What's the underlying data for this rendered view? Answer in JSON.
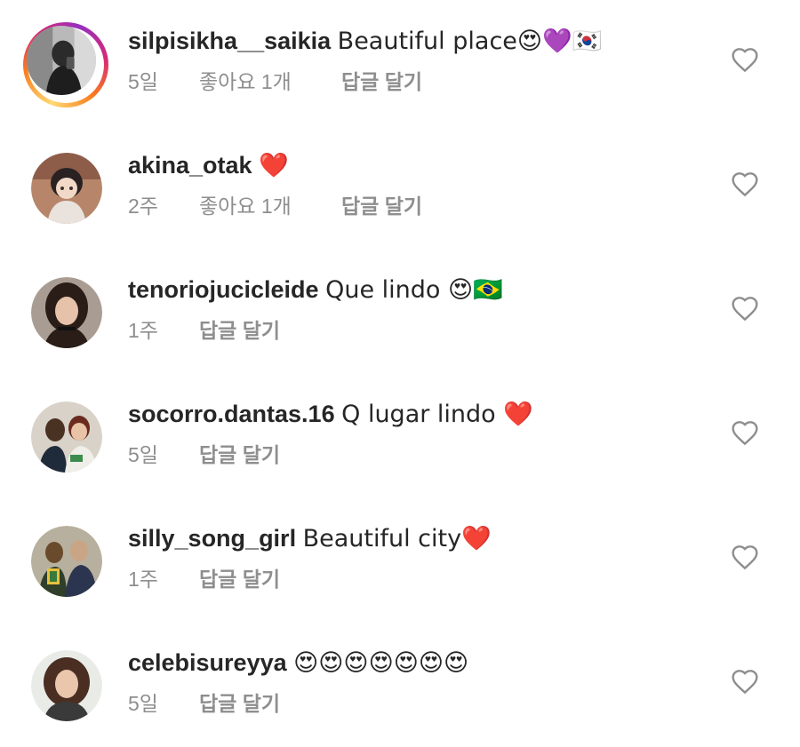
{
  "comments": [
    {
      "username": "silpisikha__saikia",
      "text": "Beautiful place😍💜🇰🇷",
      "time": "5일",
      "likes": "좋아요 1개",
      "reply": "답글 달기",
      "avatar_icon": "profile-photo-icon",
      "has_story_ring": true
    },
    {
      "username": "akina_otak",
      "text": "❤️",
      "time": "2주",
      "likes": "좋아요 1개",
      "reply": "답글 달기",
      "avatar_icon": "profile-photo-icon",
      "has_story_ring": false
    },
    {
      "username": "tenoriojucicleide",
      "text": "Que lindo 😍🇧🇷",
      "time": "1주",
      "likes": "",
      "reply": "답글 달기",
      "avatar_icon": "profile-photo-icon",
      "has_story_ring": false
    },
    {
      "username": "socorro.dantas.16",
      "text": "Q lugar lindo ❤️",
      "time": "5일",
      "likes": "",
      "reply": "답글 달기",
      "avatar_icon": "profile-photo-icon",
      "has_story_ring": false
    },
    {
      "username": "silly_song_girl",
      "text": "Beautiful city❤️",
      "time": "1주",
      "likes": "",
      "reply": "답글 달기",
      "avatar_icon": "profile-photo-icon",
      "has_story_ring": false
    },
    {
      "username": "celebisureyya",
      "text": "😍😍😍😍😍😍😍",
      "time": "5일",
      "likes": "",
      "reply": "답글 달기",
      "avatar_icon": "profile-photo-icon",
      "has_story_ring": false
    }
  ],
  "icons": {
    "like": "heart-outline-icon"
  },
  "colors": {
    "text_primary": "#262626",
    "text_secondary": "#8e8e8e",
    "icon_stroke": "#8e8e8e",
    "story_ring_start": "#feda75",
    "story_ring_end": "#d62976"
  }
}
